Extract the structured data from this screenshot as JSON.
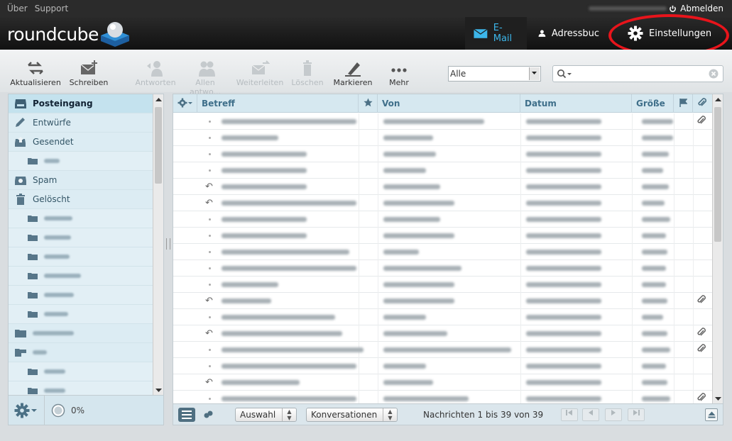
{
  "topbar": {
    "links": [
      "Über",
      "Support"
    ],
    "logout_label": "Abmelden"
  },
  "header": {
    "logo_text": "roundcube",
    "nav": {
      "email": "E-Mail",
      "addressbook": "Adressbuc",
      "settings": "Einstellungen"
    },
    "accent_color": "#3cb6ea",
    "highlight_color": "#e8141b"
  },
  "toolbar": {
    "refresh": "Aktualisieren",
    "compose": "Schreiben",
    "reply": "Antworten",
    "reply_all": "Allen antwo...",
    "forward": "Weiterleiten",
    "delete": "Löschen",
    "mark": "Markieren",
    "more": "Mehr",
    "filter_value": "Alle"
  },
  "folders": {
    "items": [
      {
        "label": "Posteingang",
        "icon": "inbox-icon"
      },
      {
        "label": "Entwürfe",
        "icon": "pencil-icon"
      },
      {
        "label": "Gesendet",
        "icon": "sent-icon"
      },
      {
        "label": "Spam",
        "icon": "spam-icon"
      },
      {
        "label": "Gelöscht",
        "icon": "trash-icon"
      }
    ],
    "quota": "0%"
  },
  "messages": {
    "columns": {
      "subject": "Betreff",
      "from": "Von",
      "date": "Datum",
      "size": "Größe"
    },
    "footer": {
      "select": "Auswahl",
      "threads": "Konversationen",
      "count": "Nachrichten 1 bis 39 von 39"
    }
  }
}
